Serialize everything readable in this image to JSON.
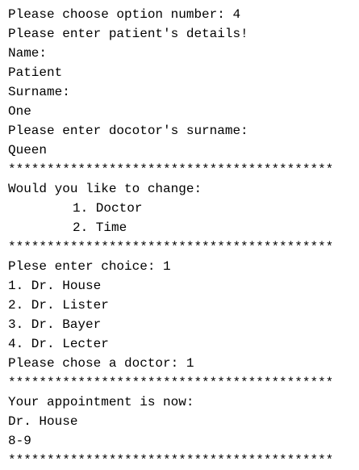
{
  "console": {
    "lines": [
      "Please choose option number: 4",
      "Please enter patient's details!",
      "Name:",
      "Patient",
      "Surname:",
      "One",
      "Please enter docotor's surname:",
      "Queen",
      "******************************************",
      "Would you like to change:",
      "1. Doctor",
      "2. Time",
      "******************************************",
      "Plese enter choice: 1",
      "1. Dr. House",
      "2. Dr. Lister",
      "3. Dr. Bayer",
      "4. Dr. Lecter",
      "Please chose a doctor: 1",
      "******************************************",
      "Your appointment is now:",
      "Dr. House",
      "8-9",
      "******************************************"
    ]
  }
}
